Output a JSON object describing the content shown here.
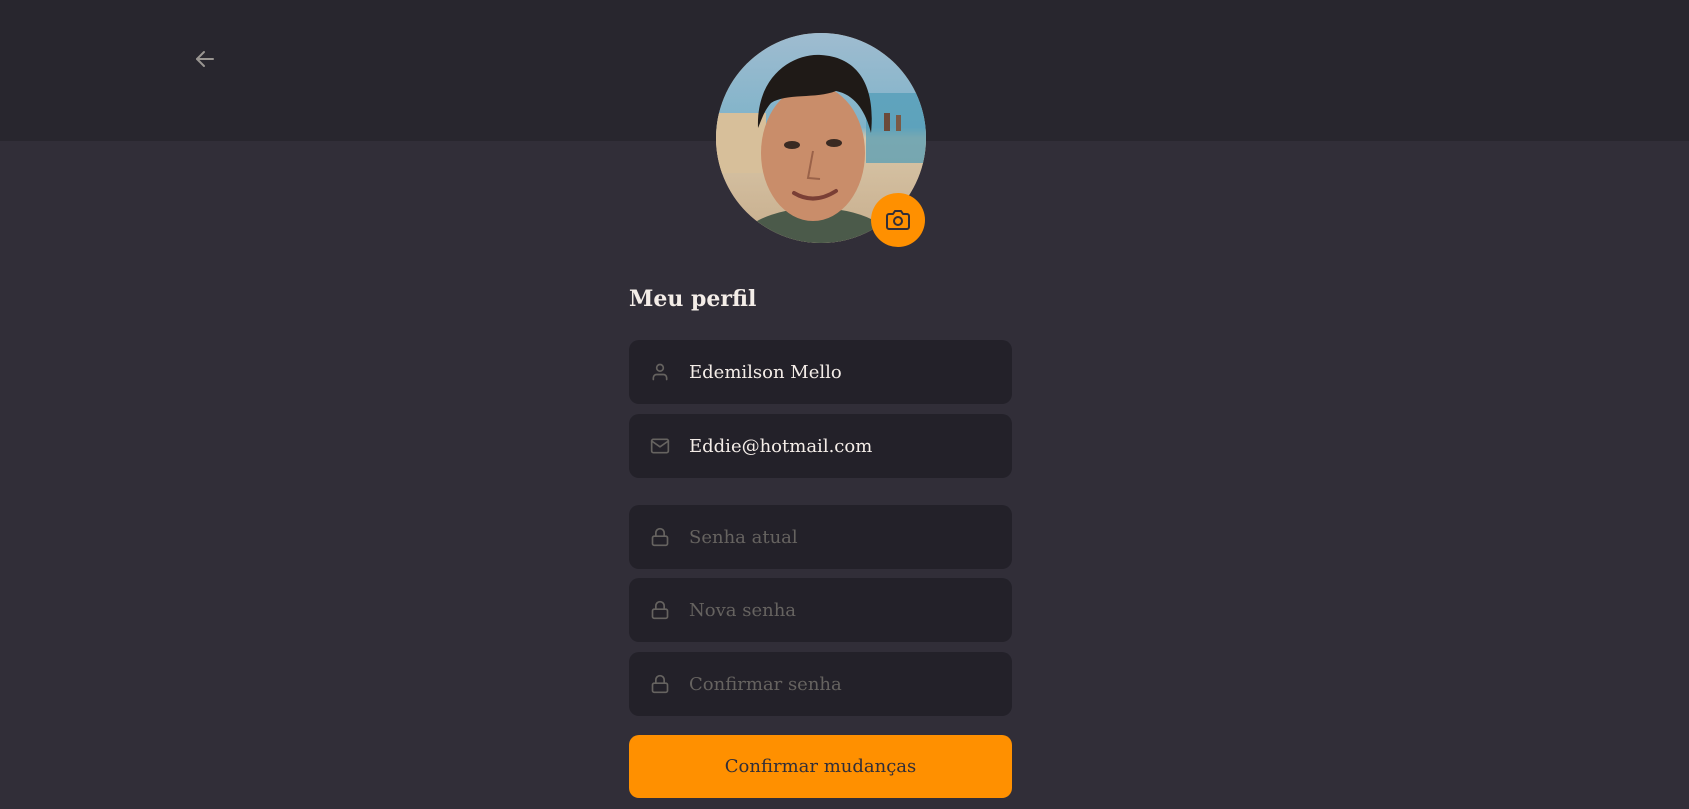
{
  "header": {
    "back_icon": "arrow-left-icon"
  },
  "profile": {
    "avatar_alt": "",
    "camera_icon": "camera-icon",
    "accent_color": "#ff9000"
  },
  "form": {
    "title": "Meu perfil",
    "name": {
      "value": "Edemilson Mello",
      "icon": "user-icon"
    },
    "email": {
      "value": "Eddie@hotmail.com",
      "icon": "mail-icon"
    },
    "old_password": {
      "placeholder": "Senha atual",
      "icon": "lock-icon"
    },
    "new_password": {
      "placeholder": "Nova senha",
      "icon": "lock-icon"
    },
    "confirm_password": {
      "placeholder": "Confirmar senha",
      "icon": "lock-icon"
    },
    "submit_label": "Confirmar mudanças"
  },
  "colors": {
    "background": "#312e38",
    "header": "#28262e",
    "input_bg": "#232129",
    "text": "#f4ede8",
    "placeholder": "#666360",
    "accent": "#ff9000"
  }
}
